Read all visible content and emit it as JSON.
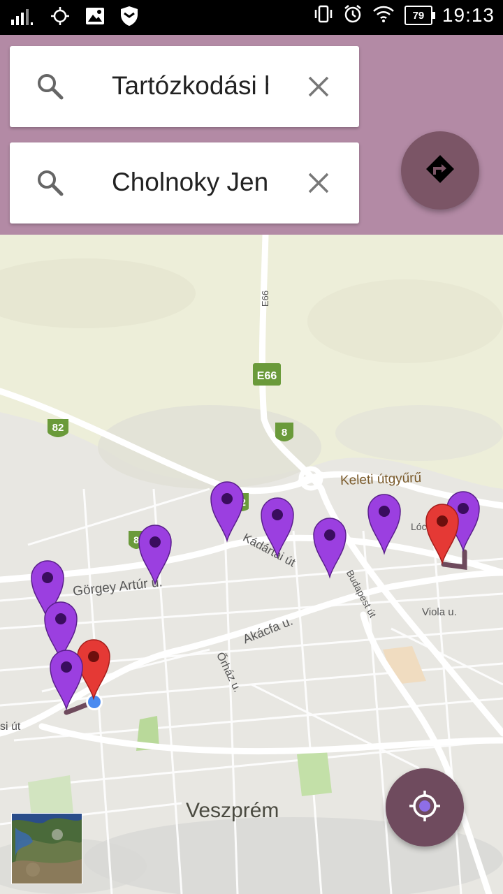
{
  "status_bar": {
    "time": "19:13",
    "battery": "79",
    "left_icons": [
      "signal-icon",
      "gps-icon",
      "image-icon",
      "shield-icon"
    ],
    "right_icons": [
      "vibrate-icon",
      "alarm-icon",
      "wifi-icon"
    ]
  },
  "search": {
    "origin_text": "Tartózkodási hely",
    "destination_text": "Cholnoky Jenő utca"
  },
  "map": {
    "city_label": "Veszprém",
    "road_labels": {
      "keleti": "Keleti útgyűrű",
      "gorgey": "Görgey Artúr u.",
      "kadartai": "Kádártai út",
      "budapest": "Budapest út",
      "akacfa": "Akácfa u.",
      "orhaz": "Őrház u.",
      "viola": "Viola u.",
      "si_ut": "si út",
      "loc_u": "Lóc    u.",
      "e66_vert": "E66"
    },
    "shields": {
      "e66": "E66",
      "s82": "82",
      "s8a": "8",
      "s8b": "8",
      "s8c": "2"
    }
  },
  "colors": {
    "header": "#b38aa5",
    "fab": "#7b5566",
    "pin_purple": "#9b3fe0",
    "pin_red": "#e53935",
    "route": "#6e4a5c"
  }
}
